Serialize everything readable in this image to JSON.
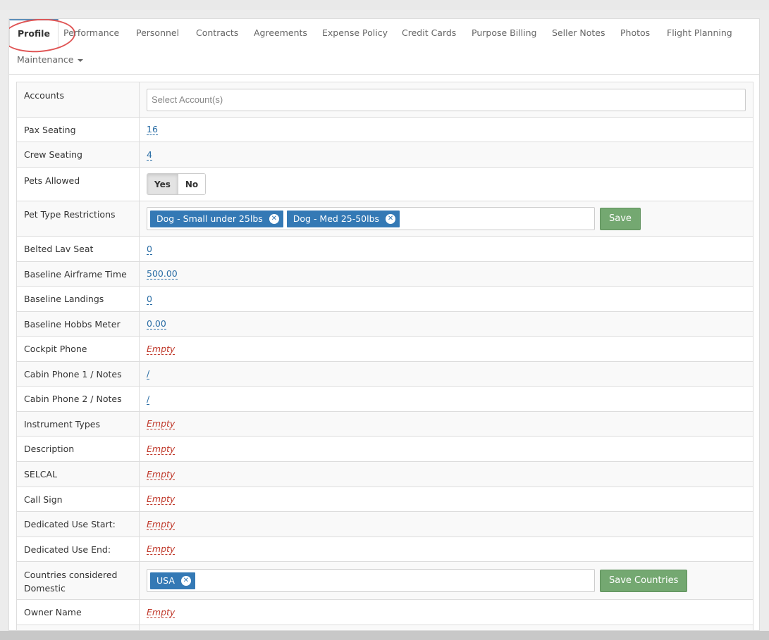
{
  "tabs": [
    {
      "label": "Profile",
      "active": true
    },
    {
      "label": "Performance"
    },
    {
      "label": "Personnel"
    },
    {
      "label": "Contracts"
    },
    {
      "label": "Agreements"
    },
    {
      "label": "Expense Policy"
    },
    {
      "label": "Credit Cards"
    },
    {
      "label": "Purpose Billing"
    },
    {
      "label": "Seller Notes"
    },
    {
      "label": "Photos"
    },
    {
      "label": "Flight Planning"
    },
    {
      "label": "Maintenance",
      "dropdown": true
    }
  ],
  "rows": {
    "accounts": {
      "label": "Accounts",
      "placeholder": "Select Account(s)"
    },
    "pax_seating": {
      "label": "Pax Seating",
      "value": "16"
    },
    "crew_seating": {
      "label": "Crew Seating",
      "value": "4"
    },
    "pets_allowed": {
      "label": "Pets Allowed",
      "yes": "Yes",
      "no": "No",
      "selected": "Yes"
    },
    "pet_type": {
      "label": "Pet Type Restrictions",
      "tags": [
        "Dog - Small under 25lbs",
        "Dog - Med 25-50lbs"
      ],
      "save": "Save"
    },
    "belted_lav": {
      "label": "Belted Lav Seat",
      "value": "0"
    },
    "baseline_airframe": {
      "label": "Baseline Airframe Time",
      "value": "500.00"
    },
    "baseline_landings": {
      "label": "Baseline Landings",
      "value": "0"
    },
    "baseline_hobbs": {
      "label": "Baseline Hobbs Meter",
      "value": "0.00"
    },
    "cockpit_phone": {
      "label": "Cockpit Phone",
      "value": "Empty"
    },
    "cabin_phone_1": {
      "label": "Cabin Phone 1 / Notes",
      "value": "/"
    },
    "cabin_phone_2": {
      "label": "Cabin Phone 2 / Notes",
      "value": "/"
    },
    "instrument_types": {
      "label": "Instrument Types",
      "value": "Empty"
    },
    "description": {
      "label": "Description",
      "value": "Empty"
    },
    "selcal": {
      "label": "SELCAL",
      "value": "Empty"
    },
    "call_sign": {
      "label": "Call Sign",
      "value": "Empty"
    },
    "dedicated_start": {
      "label": "Dedicated Use Start:",
      "value": "Empty"
    },
    "dedicated_end": {
      "label": "Dedicated Use End:",
      "value": "Empty"
    },
    "countries_domestic": {
      "label": "Countries considered Domestic",
      "tags": [
        "USA"
      ],
      "save": "Save Countries"
    },
    "owner_name": {
      "label": "Owner Name",
      "value": "Empty"
    }
  },
  "colors": {
    "link": "#2a6da5",
    "empty": "#c0392b",
    "tag": "#3479b5",
    "save_button": "#74a871",
    "annotation": "#e05555"
  }
}
